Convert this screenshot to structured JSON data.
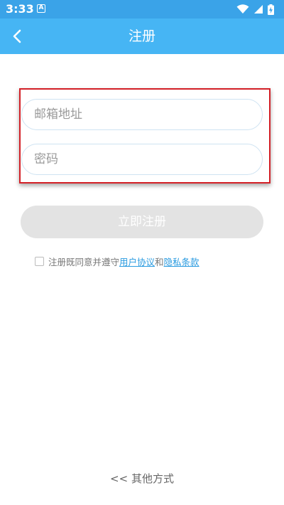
{
  "status_bar": {
    "time": "3:33",
    "notification_letter": "A"
  },
  "app_bar": {
    "title": "注册",
    "back_icon": "chevron-left-icon"
  },
  "form": {
    "email_placeholder": "邮箱地址",
    "password_placeholder": "密码",
    "register_label": "立即注册"
  },
  "agreement": {
    "prefix": "注册既同意并遵守",
    "user_agreement": "用户协议",
    "and": "和",
    "privacy_terms": "隐私条款",
    "checked": false
  },
  "footer": {
    "other_methods": "<< 其他方式"
  },
  "colors": {
    "accent": "#46b5f4",
    "status_bar": "#3aa3e8",
    "highlight": "#d32027",
    "link": "#2a9be0",
    "button_disabled": "#e3e3e3"
  }
}
